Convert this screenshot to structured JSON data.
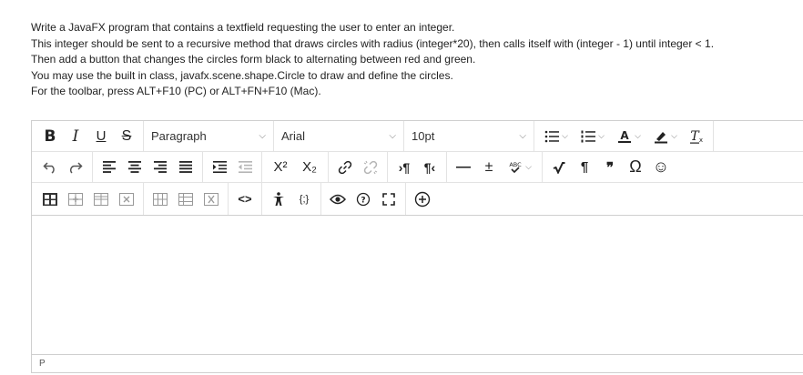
{
  "instructions": [
    "Write a JavaFX program that contains a textfield requesting the user to enter an integer.",
    "This integer should be sent to a recursive method that draws circles with radius (integer*20), then calls itself with (integer - 1) until integer < 1.",
    "Then add a button that changes the circles form black to alternating between red and green.",
    "You may use the built in class, javafx.scene.shape.Circle to draw and define the circles.",
    "For the toolbar, press ALT+F10 (PC) or ALT+FN+F10 (Mac)."
  ],
  "toolbar": {
    "bold": "B",
    "italic": "I",
    "underline": "U",
    "strikethrough": "S",
    "block_format": "Paragraph",
    "font_family": "Arial",
    "font_size": "10pt",
    "superscript": "X²",
    "subscript": "X₂",
    "ltr": "›¶",
    "rtl": "¶‹",
    "horizontal_rule": "—",
    "plus_minus": "±",
    "spellcheck": "ABC",
    "paragraph_mark": "¶",
    "blockquote": "❞",
    "omega": "Ω",
    "smiley": "☺",
    "code": "<>",
    "code_block": "{;}"
  },
  "statusbar": {
    "path": "P"
  }
}
